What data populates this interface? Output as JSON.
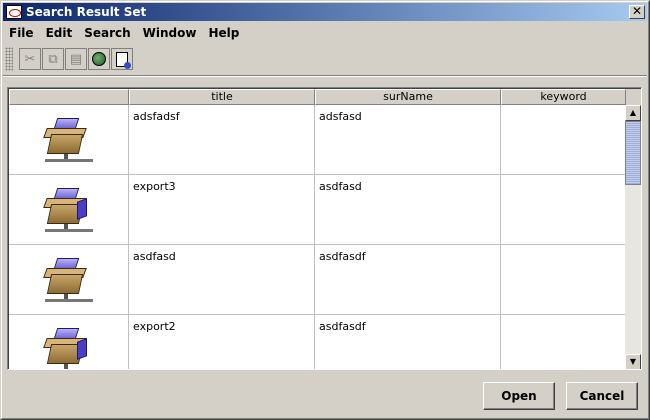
{
  "window": {
    "title": "Search Result Set",
    "close_glyph": "✕"
  },
  "menubar": {
    "items": [
      "File",
      "Edit",
      "Search",
      "Window",
      "Help"
    ]
  },
  "toolbar": {
    "icons": [
      "cut-icon",
      "copy-icon",
      "paste-icon",
      "search-globe-icon",
      "new-document-icon"
    ],
    "cut_glyph": "✂",
    "copy_glyph": "⧉",
    "paste_glyph": "▤"
  },
  "table": {
    "columns": [
      "",
      "title",
      "surName",
      "keyword"
    ],
    "rows": [
      {
        "icon": "package-icon",
        "title": "adsfadsf",
        "surName": "adsfasd",
        "keyword": ""
      },
      {
        "icon": "package-icon",
        "title": "export3",
        "surName": "asdfasd",
        "keyword": ""
      },
      {
        "icon": "package-icon",
        "title": "asdfasd",
        "surName": "asdfasdf",
        "keyword": ""
      },
      {
        "icon": "package-icon",
        "title": "export2",
        "surName": "asdfasdf",
        "keyword": ""
      }
    ]
  },
  "buttons": {
    "open_label": "Open",
    "cancel_label": "Cancel"
  },
  "colors": {
    "titlebar_start": "#0a246a",
    "titlebar_end": "#a6caf0",
    "face": "#d4d0c8"
  }
}
